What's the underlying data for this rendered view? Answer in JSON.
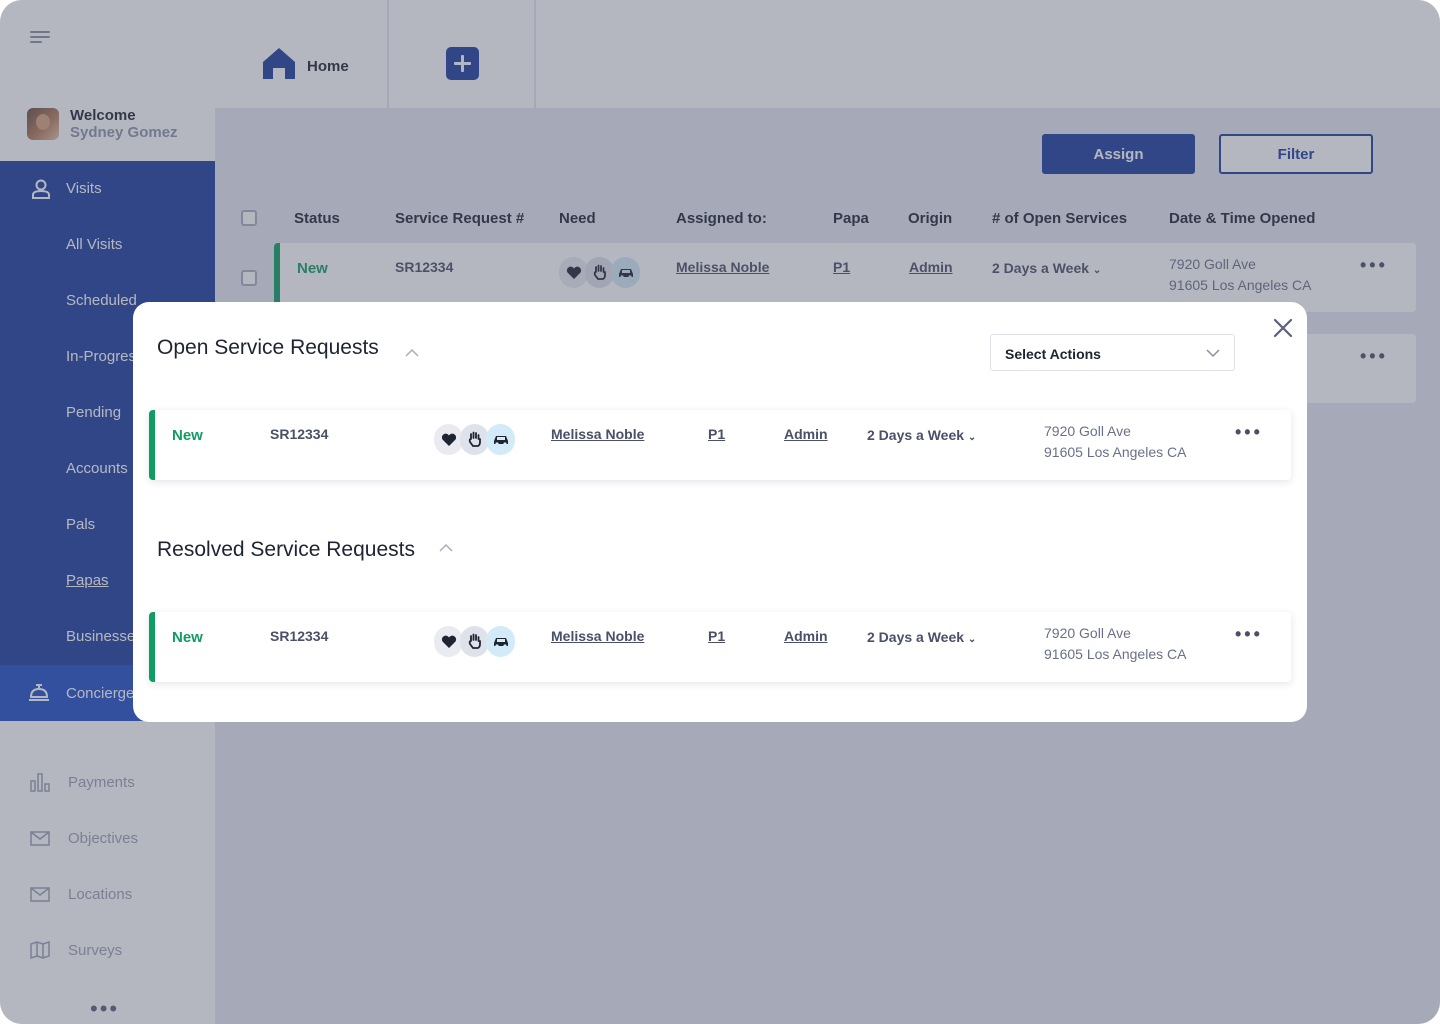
{
  "user": {
    "welcome": "Welcome",
    "name": "Sydney Gomez"
  },
  "nav": {
    "visits": "Visits",
    "sub_items": [
      "All Visits",
      "Scheduled",
      "In-Progress",
      "Pending",
      "Accounts",
      "Pals",
      "Papas",
      "Businesses"
    ],
    "concierge": "Concierge",
    "secondary": [
      "Payments",
      "Objectives",
      "Locations",
      "Surveys"
    ],
    "more": "•••"
  },
  "tabs": {
    "home": "Home"
  },
  "toolbar": {
    "assign": "Assign",
    "filter": "Filter"
  },
  "table": {
    "headers": [
      "Status",
      "Service Request #",
      "Need",
      "Assigned to:",
      "Papa",
      "Origin",
      "# of Open Services",
      "Date & Time Opened"
    ],
    "rows": [
      {
        "status": "New",
        "sr": "SR12334",
        "assigned": "Melissa Noble",
        "papa": "P1",
        "origin": "Admin",
        "frequency": "2 Days a Week",
        "addr1": "7920 Goll Ave",
        "addr2": "91605 Los Angeles CA",
        "more": "•••"
      }
    ]
  },
  "modal": {
    "open_title": "Open Service Requests",
    "resolved_title": "Resolved Service Requests",
    "select_actions": "Select Actions",
    "open_row": {
      "status": "New",
      "sr": "SR12334",
      "assigned": "Melissa Noble",
      "papa": "P1",
      "origin": "Admin",
      "frequency": "2 Days a Week",
      "addr1": "7920 Goll Ave",
      "addr2": "91605 Los Angeles CA",
      "more": "•••"
    },
    "resolved_row": {
      "status": "New",
      "sr": "SR12334",
      "assigned": "Melissa Noble",
      "papa": "P1",
      "origin": "Admin",
      "frequency": "2 Days a Week",
      "addr1": "7920 Goll Ave",
      "addr2": "91605 Los Angeles CA",
      "more": "•••"
    }
  },
  "need_icons": [
    "heart-icon",
    "hand-icon",
    "car-icon"
  ],
  "colors": {
    "primary": "#1a3d9e",
    "status_new": "#0f9d64",
    "overlay": "rgba(78,84,106,0.42)"
  }
}
